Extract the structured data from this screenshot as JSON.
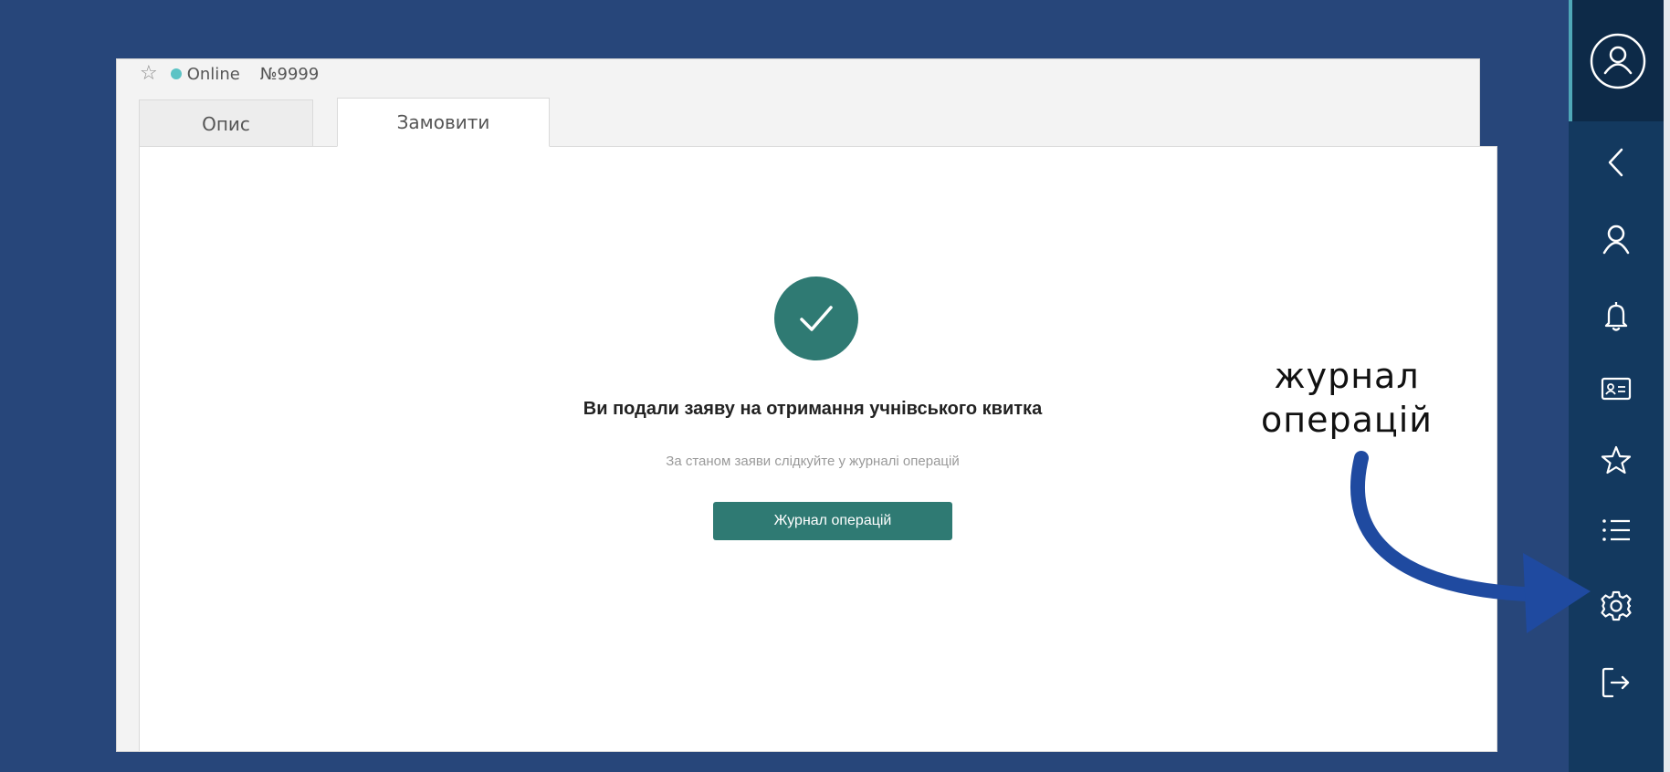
{
  "status": {
    "star_icon": "star-outline-icon",
    "online_label": "Online",
    "number": "№9999",
    "online_color": "#5cc3c5"
  },
  "tabs": [
    {
      "label": "Опис",
      "active": false
    },
    {
      "label": "Замовити",
      "active": true
    }
  ],
  "success": {
    "icon": "checkmark-icon",
    "heading": "Ви подали заяву на отримання учнівського квитка",
    "subtext": "За станом заяви слідкуйте у журналі операцій",
    "button_label": "Журнал операцій",
    "accent_color": "#2f7a73"
  },
  "annotation": {
    "line1": "журнал",
    "line2": "операцій",
    "arrow_color": "#1f4aa0"
  },
  "sidebar": {
    "avatar_icon": "profile-circle-icon",
    "items": [
      {
        "icon": "chevron-left-icon"
      },
      {
        "icon": "user-icon"
      },
      {
        "icon": "bell-icon"
      },
      {
        "icon": "id-card-icon"
      },
      {
        "icon": "star-icon"
      },
      {
        "icon": "list-icon"
      },
      {
        "icon": "gear-icon"
      },
      {
        "icon": "logout-icon"
      }
    ],
    "background": "#13395f"
  },
  "colors": {
    "page_background": "#27467a"
  }
}
